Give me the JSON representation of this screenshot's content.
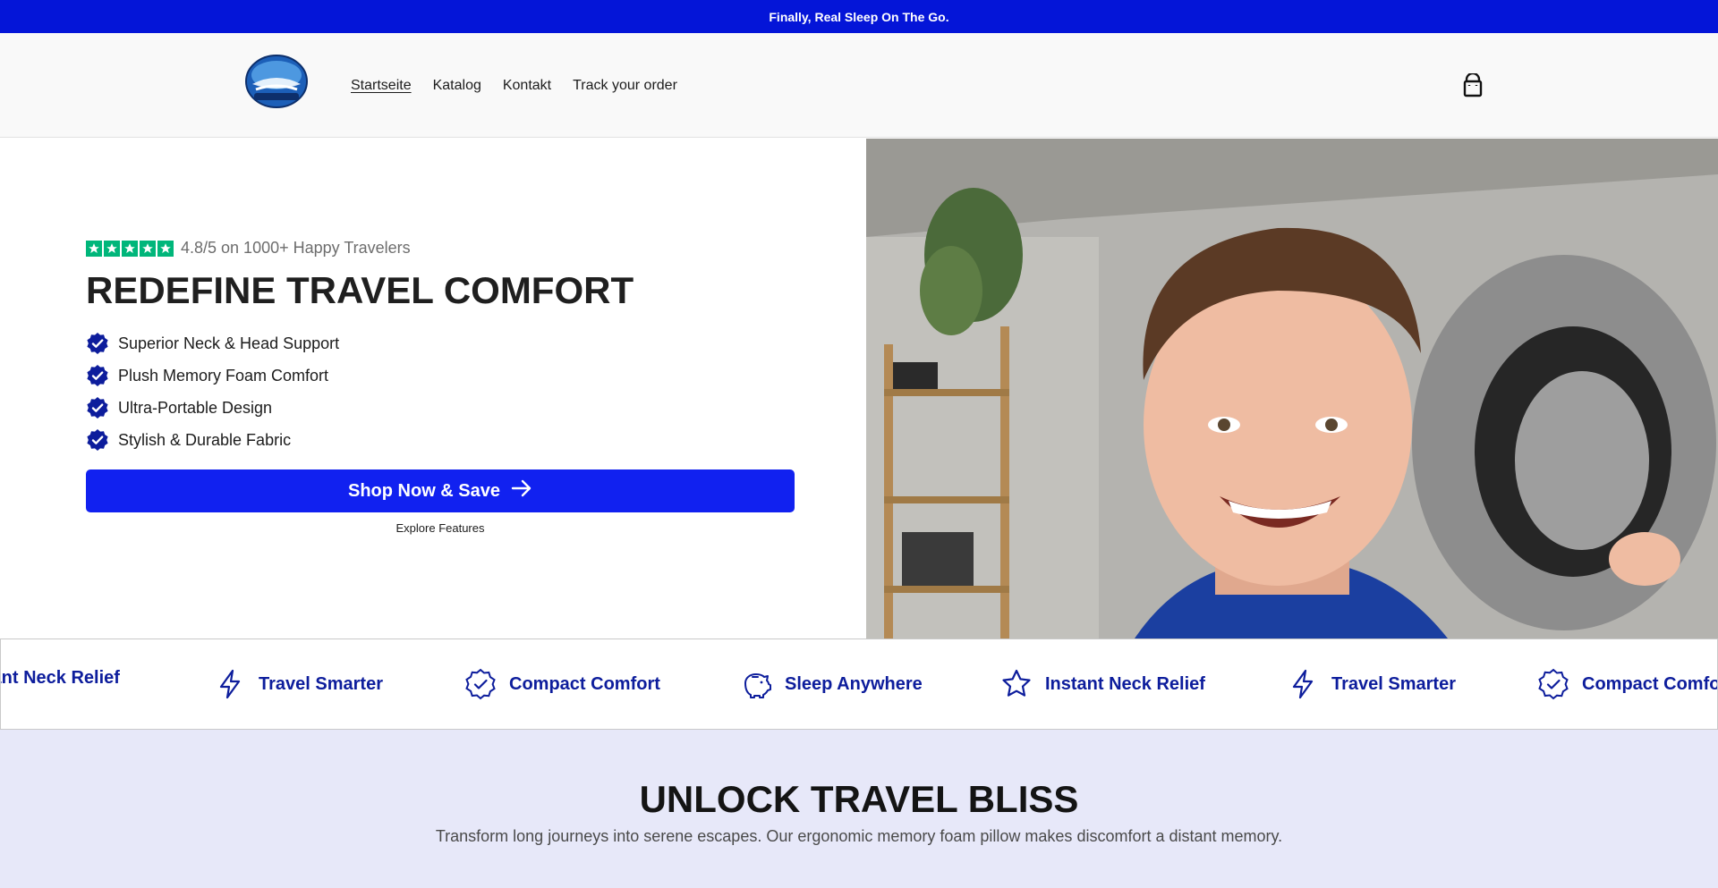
{
  "announcement": "Finally, Real Sleep On The Go.",
  "nav": {
    "items": [
      {
        "label": "Startseite",
        "active": true
      },
      {
        "label": "Katalog",
        "active": false
      },
      {
        "label": "Kontakt",
        "active": false
      },
      {
        "label": "Track your order",
        "active": false
      }
    ]
  },
  "hero": {
    "rating_text": "4.8/5 on 1000+ Happy Travelers",
    "rating_stars": 5,
    "headline": "REDEFINE TRAVEL COMFORT",
    "features": [
      "Superior Neck & Head Support",
      "Plush Memory Foam Comfort",
      "Ultra-Portable Design",
      "Stylish & Durable Fabric"
    ],
    "cta_label": "Shop Now & Save",
    "secondary_link": "Explore Features"
  },
  "marquee": {
    "items": [
      {
        "label": "Instant Neck Relief",
        "icon": "star-icon"
      },
      {
        "label": "Travel Smarter",
        "icon": "lightning-icon"
      },
      {
        "label": "Compact Comfort",
        "icon": "badge-check-icon"
      },
      {
        "label": "Sleep Anywhere",
        "icon": "piggy-bank-icon"
      },
      {
        "label": "Instant Neck Relief",
        "icon": "star-icon"
      },
      {
        "label": "Travel Smarter",
        "icon": "lightning-icon"
      },
      {
        "label": "Compact Comfort",
        "icon": "badge-check-icon"
      }
    ]
  },
  "section": {
    "title": "UNLOCK TRAVEL BLISS",
    "subtitle": "Transform long journeys into serene escapes. Our ergonomic memory foam pillow makes discomfort a distant memory."
  },
  "colors": {
    "brand_blue": "#0415d8",
    "cta_blue": "#1121f0",
    "marquee_text": "#0d1d9c",
    "trustpilot_green": "#00b67a",
    "section_bg": "#e7e8f9"
  }
}
